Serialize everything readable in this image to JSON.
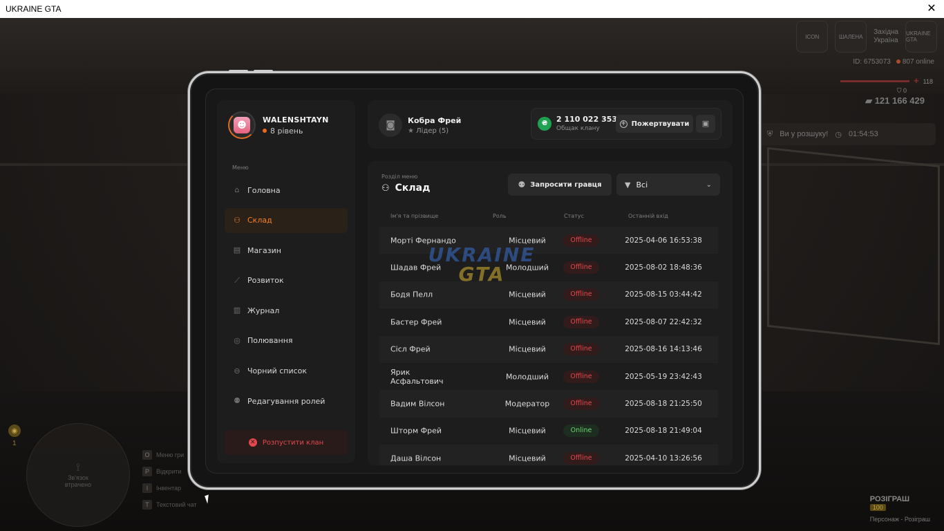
{
  "window": {
    "title": "UKRAINE GTA",
    "close": "✕"
  },
  "hud": {
    "logo1": "ICON",
    "logo2": "ШАЛЕНА",
    "region_line1": "Західна",
    "region_line2": "Україна",
    "logo3": "UKRAINE GTA",
    "id_text": "ID: 6753073",
    "online_text": "807 online",
    "health": "118",
    "armor": "0",
    "money": "121 166 429",
    "wanted_text": "Ви у розшуку!",
    "wanted_time": "01:54:53",
    "coin_count": "1",
    "minimap_line1": "Зв'язок",
    "minimap_line2": "втрачено",
    "keys": [
      {
        "key": "O",
        "label": "Меню гри"
      },
      {
        "key": "P",
        "label": "Відкрити"
      },
      {
        "key": "I",
        "label": "Інвентар"
      },
      {
        "key": "T",
        "label": "Текстовий чат"
      }
    ],
    "prize_title": "РОЗІГРАШ",
    "prize_badge": "100",
    "prize_sub": "Персонаж - Розіграш"
  },
  "profile": {
    "name": "WALENSHTAYN",
    "level": "8 рівень"
  },
  "menu": {
    "label": "Меню",
    "items": [
      {
        "label": "Головна",
        "icon": "home-icon",
        "glyph": "⌂"
      },
      {
        "label": "Склад",
        "icon": "people-icon",
        "glyph": "⚇"
      },
      {
        "label": "Магазин",
        "icon": "basket-icon",
        "glyph": "▤"
      },
      {
        "label": "Розвиток",
        "icon": "chart-icon",
        "glyph": "⟋"
      },
      {
        "label": "Журнал",
        "icon": "book-icon",
        "glyph": "▥"
      },
      {
        "label": "Полювання",
        "icon": "target-icon",
        "glyph": "◎"
      },
      {
        "label": "Чорний список",
        "icon": "block-icon",
        "glyph": "⊖"
      },
      {
        "label": "Редагування ролей",
        "icon": "user-edit-icon",
        "glyph": "⚉"
      }
    ],
    "active_index": 1,
    "disband": "Розпустити клан"
  },
  "leader": {
    "name": "Кобра Фрей",
    "role": "Лідер (5)"
  },
  "bank": {
    "amount": "2 110 022 353",
    "label": "Общак клану",
    "donate": "Пожертвувати",
    "coin_glyph": "₴"
  },
  "section": {
    "label": "Розділ меню",
    "title": "Склад",
    "invite": "Запросити гравця",
    "filter": "Всі"
  },
  "table": {
    "headers": {
      "name": "Ім'я та прізвище",
      "role": "Роль",
      "status": "Статус",
      "last": "Останній вхід"
    },
    "rows": [
      {
        "name": "Морті Фернандо",
        "role": "Місцевий",
        "status": "Offline",
        "last": "2025-04-06 16:53:38"
      },
      {
        "name": "Шадав Фрей",
        "role": "Молодший",
        "status": "Offline",
        "last": "2025-08-02 18:48:36"
      },
      {
        "name": "Бодя Пелл",
        "role": "Місцевий",
        "status": "Offline",
        "last": "2025-08-15 03:44:42"
      },
      {
        "name": "Бастер Фрей",
        "role": "Місцевий",
        "status": "Offline",
        "last": "2025-08-07 22:42:32"
      },
      {
        "name": "Сісл Фрей",
        "role": "Місцевий",
        "status": "Offline",
        "last": "2025-08-16 14:13:46"
      },
      {
        "name": "Ярик Асфальтович",
        "role": "Молодший",
        "status": "Offline",
        "last": "2025-05-19 23:42:43"
      },
      {
        "name": "Вадим Вілсон",
        "role": "Модератор",
        "status": "Offline",
        "last": "2025-08-18 21:25:50"
      },
      {
        "name": "Шторм Фрей",
        "role": "Місцевий",
        "status": "Online",
        "last": "2025-08-18 21:49:04"
      },
      {
        "name": "Даша Вілсон",
        "role": "Місцевий",
        "status": "Offline",
        "last": "2025-04-10 13:26:56"
      }
    ]
  },
  "watermark": {
    "line1": "UKRAINE",
    "line2": "GTA"
  },
  "colors": {
    "accent": "#ff7e1f",
    "online": "#6cd66e",
    "offline": "#e4484e",
    "money": "#1fa353"
  }
}
